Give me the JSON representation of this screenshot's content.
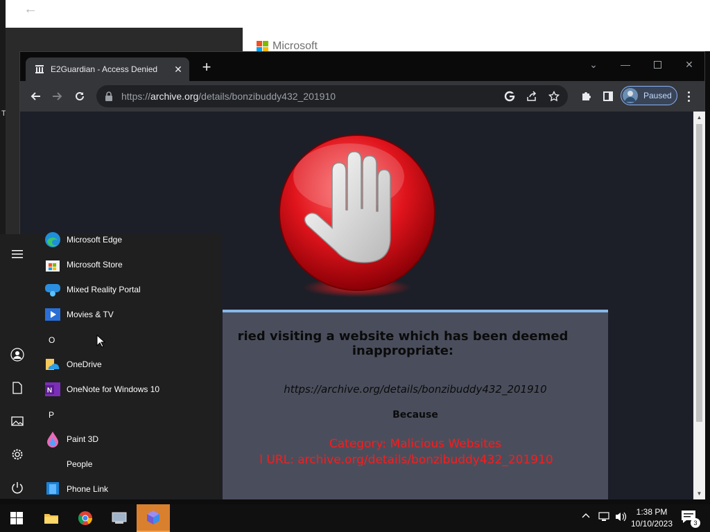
{
  "background": {
    "brand_text": "Microsoft",
    "side_letter": "T"
  },
  "browser": {
    "tab_title": "E2Guardian - Access Denied",
    "url_scheme": "https://",
    "url_host": "archive.org",
    "url_path": "/details/bonzibuddy432_201910",
    "profile_label": "Paused"
  },
  "page": {
    "message_line": "ried visiting a website which has been deemed inappropriate:",
    "blocked_url": "https://archive.org/details/bonzibuddy432_201910",
    "because_label": "Because",
    "category_text": "Category: Malicious Websites",
    "blocked_url_text": "l URL: archive.org/details/bonzibuddy432_201910"
  },
  "start_menu": {
    "apps": [
      {
        "label": "Microsoft Edge",
        "icon": "edge-icon"
      },
      {
        "label": "Microsoft Store",
        "icon": "store-icon"
      },
      {
        "label": "Mixed Reality Portal",
        "icon": "mixed-reality-icon"
      },
      {
        "label": "Movies & TV",
        "icon": "movies-icon"
      },
      {
        "label": "OneDrive",
        "icon": "onedrive-icon"
      },
      {
        "label": "OneNote for Windows 10",
        "icon": "onenote-icon"
      },
      {
        "label": "Paint 3D",
        "icon": "paint3d-icon"
      },
      {
        "label": "People",
        "icon": ""
      },
      {
        "label": "Phone Link",
        "icon": "phone-link-icon"
      }
    ],
    "letters": [
      "O",
      "P"
    ]
  },
  "taskbar": {
    "time": "1:38 PM",
    "date": "10/10/2023",
    "notification_count": "3"
  },
  "colors": {
    "accent_red": "#ff1a1a",
    "message_box": "#4a4e5c",
    "message_box_border": "#86b8e6",
    "taskbar_active": "#d9802f"
  }
}
